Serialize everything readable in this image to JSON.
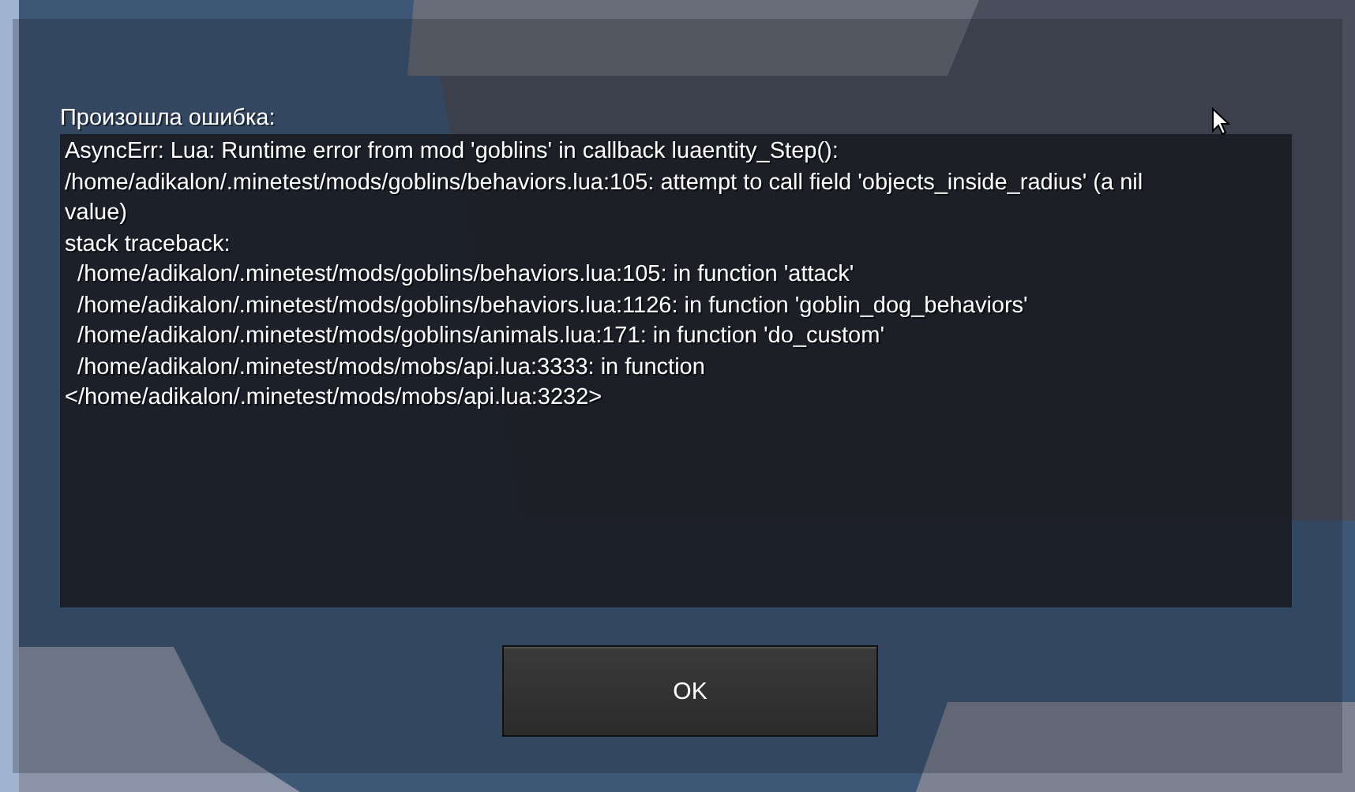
{
  "dialog": {
    "heading": "Произошла ошибка:",
    "message_lines": [
      "AsyncErr: Lua: Runtime error from mod 'goblins' in callback luaentity_Step():",
      "/home/adikalon/.minetest/mods/goblins/behaviors.lua:105: attempt to call field 'objects_inside_radius' (a nil",
      "value)",
      "stack traceback:",
      "  /home/adikalon/.minetest/mods/goblins/behaviors.lua:105: in function 'attack'",
      "  /home/adikalon/.minetest/mods/goblins/behaviors.lua:1126: in function 'goblin_dog_behaviors'",
      "  /home/adikalon/.minetest/mods/goblins/animals.lua:171: in function 'do_custom'",
      "  /home/adikalon/.minetest/mods/mobs/api.lua:3333: in function",
      "</home/adikalon/.minetest/mods/mobs/api.lua:3232>"
    ],
    "buttons": [
      "OK"
    ]
  }
}
